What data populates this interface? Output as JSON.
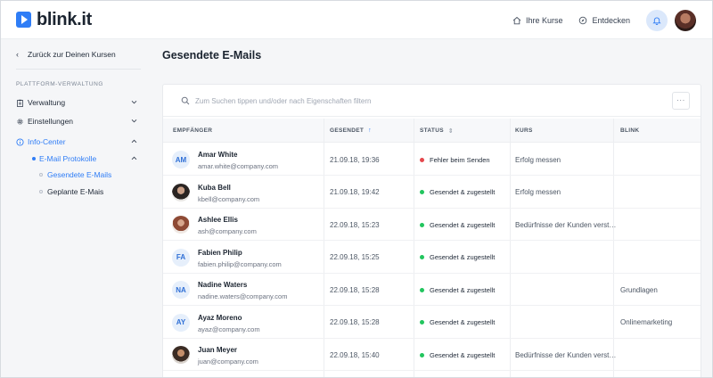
{
  "app": {
    "logo_text": "blink.it"
  },
  "header": {
    "nav": [
      {
        "label": "Ihre Kurse",
        "icon": "home-icon"
      },
      {
        "label": "Entdecken",
        "icon": "compass-icon"
      }
    ],
    "bell_icon": "bell-icon"
  },
  "sidebar": {
    "back_label": "Zurück zur Deinen Kursen",
    "section_label": "PLATTFORM-VERWALTUNG",
    "items": [
      {
        "label": "Verwaltung",
        "icon": "clipboard-icon"
      },
      {
        "label": "Einstellungen",
        "icon": "gear-icon"
      },
      {
        "label": "Info-Center",
        "icon": "info-icon"
      }
    ],
    "sub_item": {
      "label": "E-Mail Protokolle"
    },
    "sub_sub_items": [
      {
        "label": "Gesendete E-Mails"
      },
      {
        "label": "Geplante E-Mais"
      }
    ]
  },
  "main": {
    "title": "Gesendete E-Mails",
    "search_placeholder": "Zum Suchen tippen und/oder nach Eigenschaften filtern",
    "more_label": "···",
    "columns": [
      "EMPFÄNGER",
      "GESENDET",
      "STATUS",
      "KURS",
      "BLINK"
    ],
    "rows": [
      {
        "avatar": "AM",
        "name": "Amar White",
        "email": "amar.white@company.com",
        "sent": "21.09.18, 19:36",
        "status": "Fehler beim Senden",
        "kurs": "Erfolg messen",
        "blink": ""
      },
      {
        "avatar": "",
        "name": "Kuba Bell",
        "email": "kbell@company.com",
        "sent": "21.09.18, 19:42",
        "status": "Gesendet & zugestellt",
        "kurs": "Erfolg messen",
        "blink": ""
      },
      {
        "avatar": "",
        "name": "Ashlee Ellis",
        "email": "ash@company.com",
        "sent": "22.09.18, 15:23",
        "status": "Gesendet & zugestellt",
        "kurs": "Bedürfnisse der Kunden verst…",
        "blink": ""
      },
      {
        "avatar": "FA",
        "name": "Fabien Philip",
        "email": "fabien.philip@company.com",
        "sent": "22.09.18, 15:25",
        "status": "Gesendet & zugestellt",
        "kurs": "",
        "blink": ""
      },
      {
        "avatar": "NA",
        "name": "Nadine Waters",
        "email": "nadine.waters@company.com",
        "sent": "22.09.18, 15:28",
        "status": "Gesendet & zugestellt",
        "kurs": "",
        "blink": "Grundlagen"
      },
      {
        "avatar": "AY",
        "name": "Ayaz Moreno",
        "email": "ayaz@company.com",
        "sent": "22.09.18, 15:28",
        "status": "Gesendet & zugestellt",
        "kurs": "",
        "blink": "Onlinemarketing"
      },
      {
        "avatar": "",
        "name": "Juan Meyer",
        "email": "juan@company.com",
        "sent": "22.09.18, 15:40",
        "status": "Gesendet & zugestellt",
        "kurs": "Bedürfnisse der Kunden verst…",
        "blink": ""
      }
    ]
  },
  "colors": {
    "accent": "#2f7df6",
    "error": "#e5484d",
    "success": "#22c55e"
  }
}
